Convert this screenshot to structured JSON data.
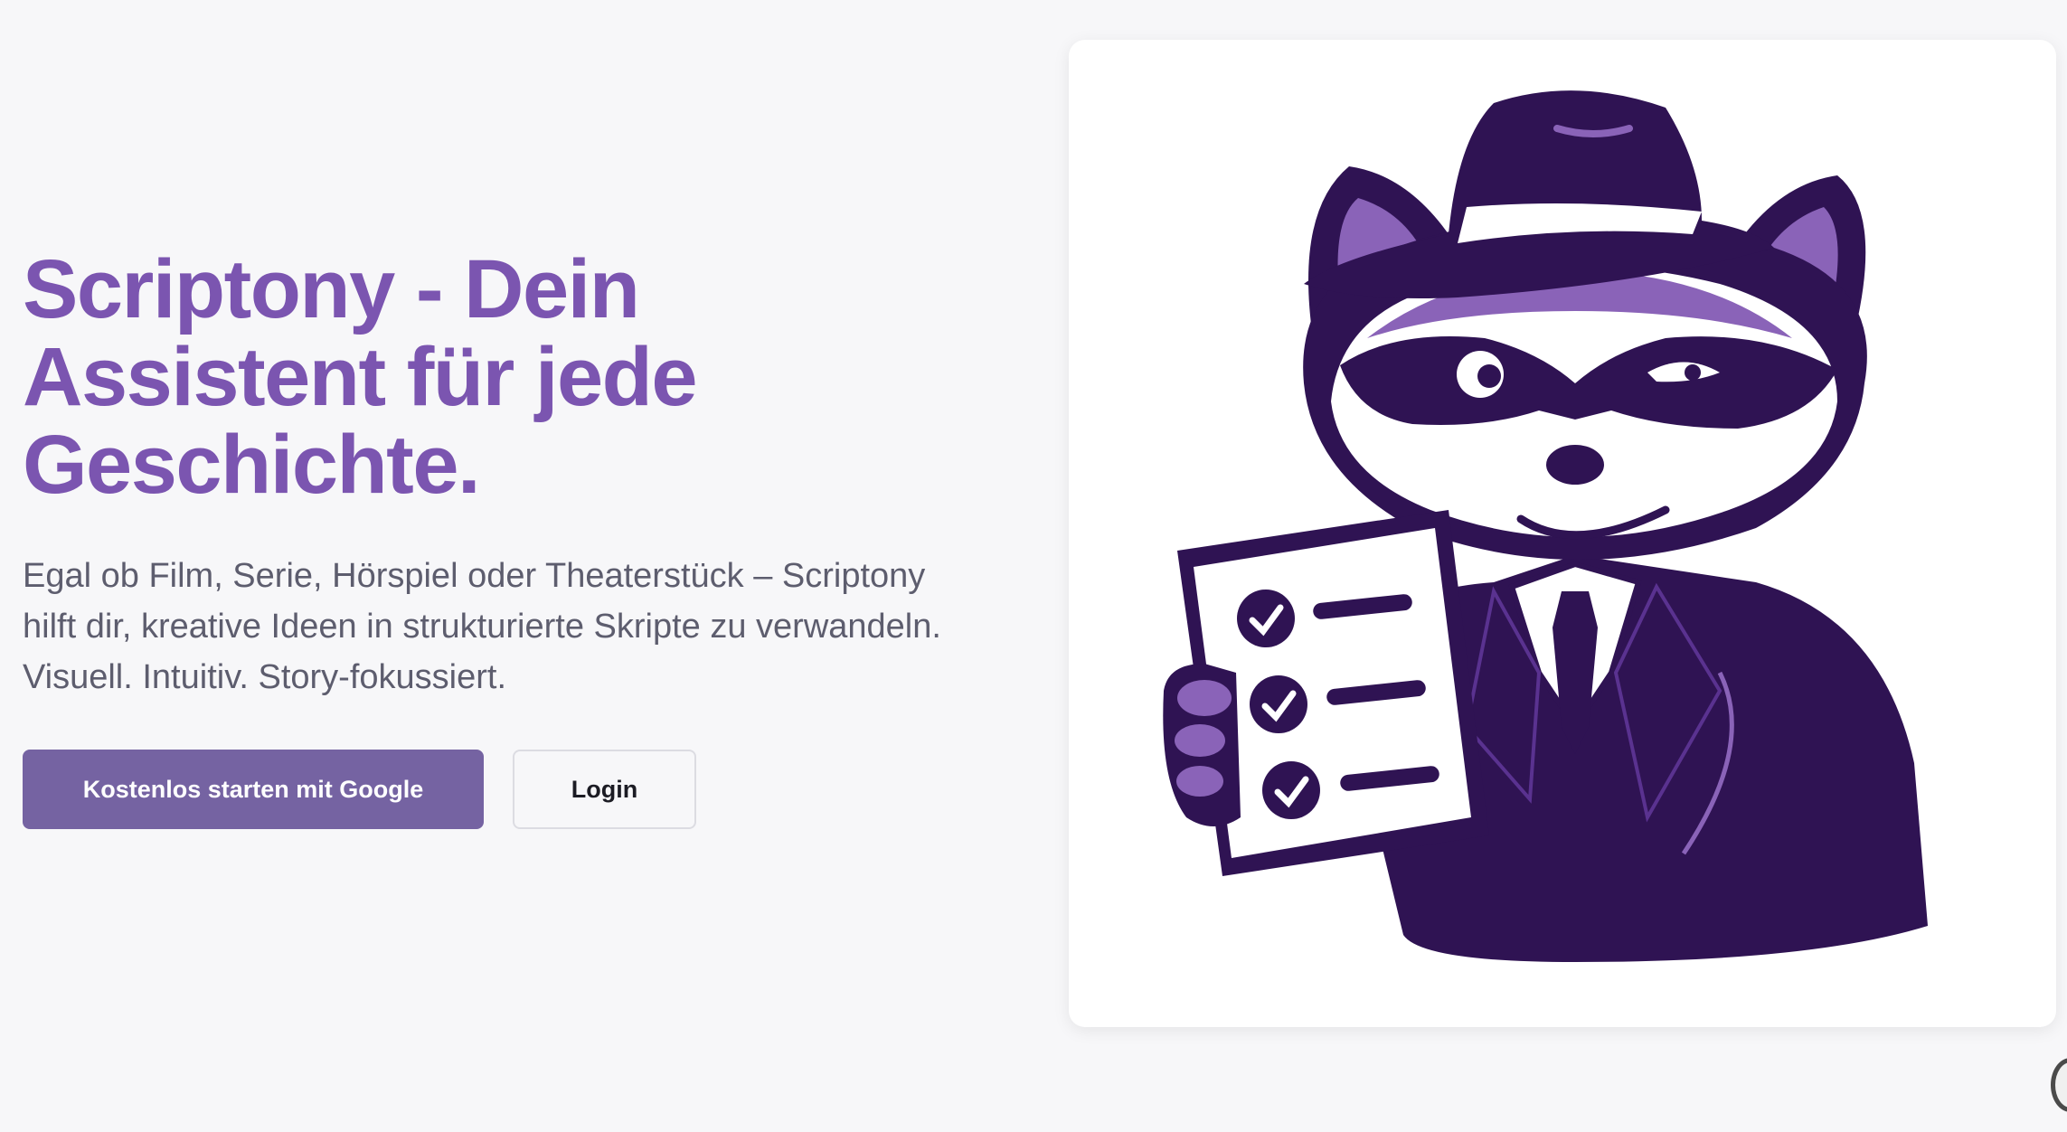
{
  "hero": {
    "headline": "Scriptony - Dein\nAssistent für jede\nGeschichte.",
    "subtext": "Egal ob Film, Serie, Hörspiel oder Theaterstück – Scriptony\nhilft dir, kreative Ideen in strukturierte Skripte zu verwandeln.\nVisuell. Intuitiv. Story-fokussiert.",
    "primary_button": "Kostenlos starten mit Google",
    "secondary_button": "Login"
  },
  "illustration": {
    "subject": "raccoon-mascot",
    "colors": {
      "dark_purple": "#2f1353",
      "light_purple": "#8a63b8",
      "white": "#ffffff"
    }
  },
  "colors": {
    "page_background": "#f7f7f9",
    "headline": "#7b55b0",
    "body_text": "#5d5d6e",
    "primary_button": "#7563a2",
    "card_background": "#ffffff"
  }
}
